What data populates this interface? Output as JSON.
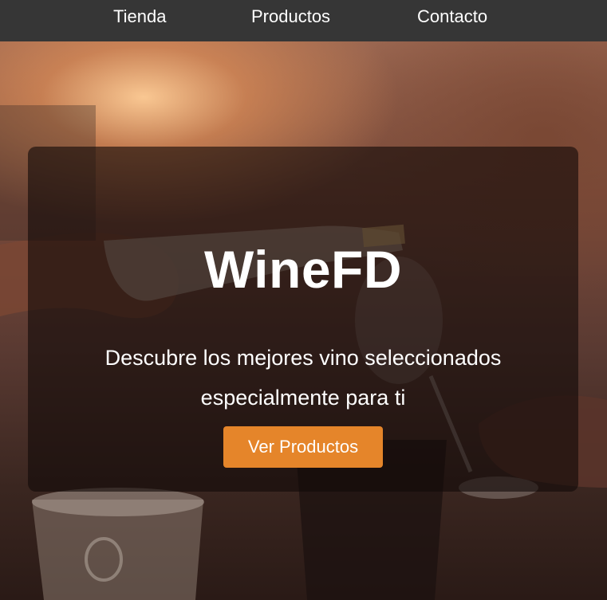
{
  "nav": {
    "links": [
      {
        "label": "Tienda"
      },
      {
        "label": "Productos"
      },
      {
        "label": "Contacto"
      }
    ]
  },
  "hero": {
    "title": "WineFD",
    "tagline": "Descubre los mejores vino seleccionados especialmente para ti",
    "cta_label": "Ver Productos"
  },
  "colors": {
    "navbar": "#363636",
    "accent": "#e5852a",
    "overlay": "rgba(18,10,8,0.62)"
  }
}
